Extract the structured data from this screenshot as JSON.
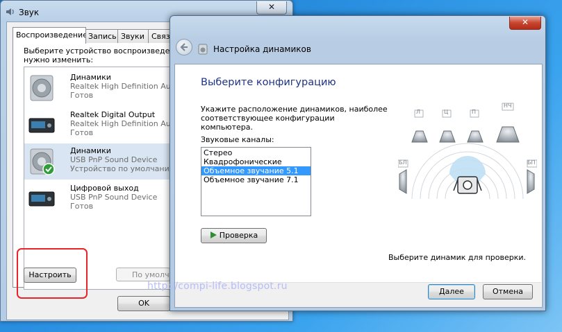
{
  "sound_window": {
    "title": "Звук",
    "close_glyph": "✕",
    "tabs": [
      {
        "label": "Воспроизведение"
      },
      {
        "label": "Запись"
      },
      {
        "label": "Звуки"
      },
      {
        "label": "Связь"
      }
    ],
    "instruction_line1": "Выберите устройство воспроизведен",
    "instruction_line2": "нужно изменить:",
    "devices": [
      {
        "name": "Динамики",
        "driver": "Realtek High Definition Audi",
        "status": "Готов",
        "icon": "speaker-icon"
      },
      {
        "name": "Realtek Digital Output",
        "driver": "Realtek High Definition Audi",
        "status": "Готов",
        "icon": "digital-output-icon"
      },
      {
        "name": "Динамики",
        "driver": "USB PnP Sound Device",
        "status": "Устройство по умолчанию",
        "icon": "speaker-default-icon"
      },
      {
        "name": "Цифровой выход",
        "driver": "USB PnP Sound Device",
        "status": "Готов",
        "icon": "digital-output-icon"
      }
    ],
    "configure_button": "Настроить",
    "default_button": "По умолч",
    "ok_button": "OK"
  },
  "watermark_url": "http://compi-life.blogspot.ru",
  "speaker_window": {
    "title": "Настройка динамиков",
    "close_glyph": "✕",
    "heading": "Выберите конфигурацию",
    "description_line1": "Укажите расположение динамиков, наиболее",
    "description_line2": "соответствующее конфигурации компьютера.",
    "channels_label": "Звуковые каналы:",
    "channels": [
      "Стерео",
      "Квадрофонические",
      "Объемное звучание 5.1",
      "Объемное звучание 7.1"
    ],
    "selected_channel_index": 2,
    "test_button": "Проверка",
    "hint": "Выберите динамик для проверки.",
    "next_button": "Далее",
    "cancel_button": "Отмена",
    "speaker_labels": {
      "left": "Л",
      "center": "Ц",
      "right": "П",
      "sub": "НЧ",
      "rear_left": "БЛ",
      "rear_right": "БП"
    }
  },
  "colors": {
    "heading": "#1e3287",
    "selection": "#3399ff",
    "highlight_box": "#e8232a",
    "play_icon": "#2f8e2f"
  }
}
